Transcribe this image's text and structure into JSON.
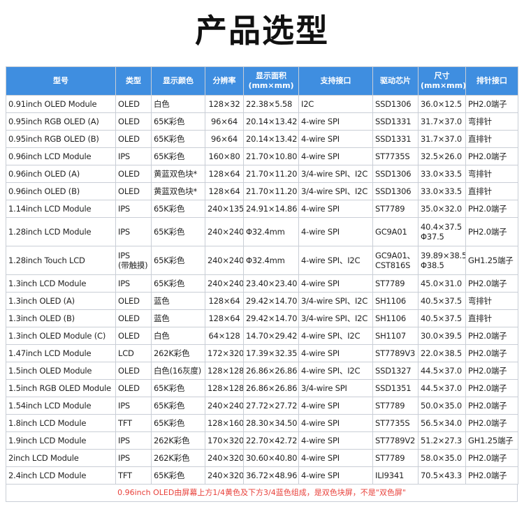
{
  "title": "产品选型",
  "table": {
    "headers": [
      "型号",
      "类型",
      "显示颜色",
      "分辨率",
      "显示面积\n(mm×mm)",
      "支持接口",
      "驱动芯片",
      "尺寸\n(mm×mm)",
      "排针接口"
    ],
    "rows": [
      [
        "0.91inch OLED Module",
        "OLED",
        "白色",
        "128×32",
        "22.38×5.58",
        "I2C",
        "SSD1306",
        "36.0×12.5",
        "PH2.0端子"
      ],
      [
        "0.95inch RGB OLED (A)",
        "OLED",
        "65K彩色",
        "96×64",
        "20.14×13.42",
        "4-wire SPI",
        "SSD1331",
        "31.7×37.0",
        "弯排针"
      ],
      [
        "0.95inch RGB OLED (B)",
        "OLED",
        "65K彩色",
        "96×64",
        "20.14×13.42",
        "4-wire SPI",
        "SSD1331",
        "31.7×37.0",
        "直排针"
      ],
      [
        "0.96inch LCD Module",
        "IPS",
        "65K彩色",
        "160×80",
        "21.70×10.80",
        "4-wire SPI",
        "ST7735S",
        "32.5×26.0",
        "PH2.0端子"
      ],
      [
        "0.96inch OLED (A)",
        "OLED",
        "黄蓝双色块*",
        "128×64",
        "21.70×11.20",
        "3/4-wire SPI、I2C",
        "SSD1306",
        "33.0×33.5",
        "弯排针"
      ],
      [
        "0.96inch OLED (B)",
        "OLED",
        "黄蓝双色块*",
        "128×64",
        "21.70×11.20",
        "3/4-wire SPI、I2C",
        "SSD1306",
        "33.0×33.5",
        "直排针"
      ],
      [
        "1.14inch LCD Module",
        "IPS",
        "65K彩色",
        "240×135",
        "24.91×14.86",
        "4-wire SPI",
        "ST7789",
        "35.0×32.0",
        "PH2.0端子"
      ],
      [
        "1.28inch LCD Module",
        "IPS",
        "65K彩色",
        "240×240",
        "Φ32.4mm",
        "4-wire SPI",
        "GC9A01",
        "40.4×37.5\nΦ37.5",
        "PH2.0端子"
      ],
      [
        "1.28inch Touch LCD",
        "IPS\n(带触摸)",
        "65K彩色",
        "240×240",
        "Φ32.4mm",
        "4-wire SPI、I2C",
        "GC9A01、\nCST816S",
        "39.89×38.5\nΦ38.5",
        "GH1.25端子"
      ],
      [
        "1.3inch LCD Module",
        "IPS",
        "65K彩色",
        "240×240",
        "23.40×23.40",
        "4-wire SPI",
        "ST7789",
        "45.0×31.0",
        "PH2.0端子"
      ],
      [
        "1.3inch OLED (A)",
        "OLED",
        "蓝色",
        "128×64",
        "29.42×14.70",
        "3/4-wire SPI、I2C",
        "SH1106",
        "40.5×37.5",
        "弯排针"
      ],
      [
        "1.3inch OLED (B)",
        "OLED",
        "蓝色",
        "128×64",
        "29.42×14.70",
        "3/4-wire SPI、I2C",
        "SH1106",
        "40.5×37.5",
        "直排针"
      ],
      [
        "1.3inch OLED Module (C)",
        "OLED",
        "白色",
        "64×128",
        "14.70×29.42",
        "4-wire SPI、I2C",
        "SH1107",
        "30.0×39.5",
        "PH2.0端子"
      ],
      [
        "1.47inch LCD Module",
        "LCD",
        "262K彩色",
        "172×320",
        "17.39×32.35",
        "4-wire SPI",
        "ST7789V3",
        "22.0×38.5",
        "PH2.0端子"
      ],
      [
        "1.5inch OLED Module",
        "OLED",
        "白色(16灰度)",
        "128×128",
        "26.86×26.86",
        "4-wire SPI、I2C",
        "SSD1327",
        "44.5×37.0",
        "PH2.0端子"
      ],
      [
        "1.5inch RGB OLED Module",
        "OLED",
        "65K彩色",
        "128×128",
        "26.86×26.86",
        "3/4-wire SPI",
        "SSD1351",
        "44.5×37.0",
        "PH2.0端子"
      ],
      [
        "1.54inch LCD Module",
        "IPS",
        "65K彩色",
        "240×240",
        "27.72×27.72",
        "4-wire SPI",
        "ST7789",
        "50.0×35.0",
        "PH2.0端子"
      ],
      [
        "1.8inch LCD Module",
        "TFT",
        "65K彩色",
        "128×160",
        "28.30×34.50",
        "4-wire SPI",
        "ST7735S",
        "56.5×34.0",
        "PH2.0端子"
      ],
      [
        "1.9inch LCD Module",
        "IPS",
        "262K彩色",
        "170×320",
        "22.70×42.72",
        "4-wire SPI",
        "ST7789V2",
        "51.2×27.3",
        "GH1.25端子"
      ],
      [
        "2inch LCD Module",
        "IPS",
        "262K彩色",
        "240×320",
        "30.60×40.80",
        "4-wire SPI",
        "ST7789",
        "58.0×35.0",
        "PH2.0端子"
      ],
      [
        "2.4inch LCD Module",
        "TFT",
        "65K彩色",
        "240×320",
        "36.72×48.96",
        "4-wire SPI",
        "ILI9341",
        "70.5×43.3",
        "PH2.0端子"
      ]
    ],
    "tall_rows": [
      7,
      8
    ]
  },
  "note": "0.96inch OLED由屏幕上方1/4黄色及下方3/4蓝色组成，是双色块屏，不是\"双色屏\"",
  "colors": {
    "header_bg": "#3f8ee0",
    "model_text": "#2f80d8",
    "note_text": "#e8403a"
  }
}
